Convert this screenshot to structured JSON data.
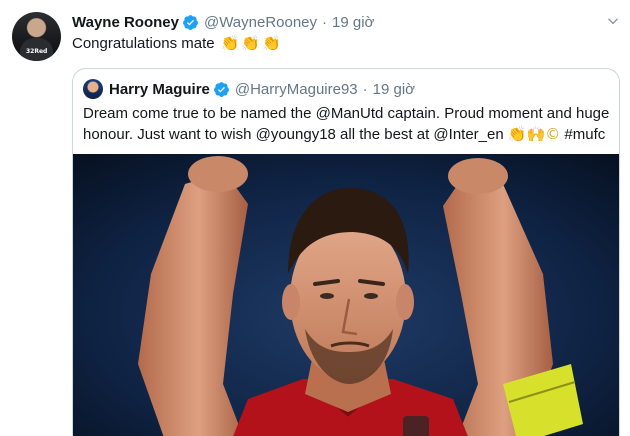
{
  "tweet": {
    "author_name": "Wayne Rooney",
    "handle": "@WayneRooney",
    "separator": "·",
    "time": "19 giờ",
    "text": "Congratulations mate",
    "emoji": [
      "👏",
      "👏",
      "👏"
    ],
    "avatar_sponsor": "32Red"
  },
  "quoted": {
    "author_name": "Harry Maguire",
    "handle": "@HarryMaguire93",
    "separator": "·",
    "time": "19 giờ",
    "text_line1": "Dream come true to be named the @ManUtd captain. Proud moment and huge",
    "text_line2": "honour. Just want to wish @youngy18 all the best at @Inter_en",
    "text_emoji": "👏🙌©",
    "text_hashtag": "#mufc"
  },
  "icons": {
    "verified": "verified-badge-icon",
    "caret": "chevron-down-icon"
  },
  "colors": {
    "verified_blue": "#1da1f2",
    "secondary_text": "#657786",
    "border": "#ccd6dd"
  }
}
